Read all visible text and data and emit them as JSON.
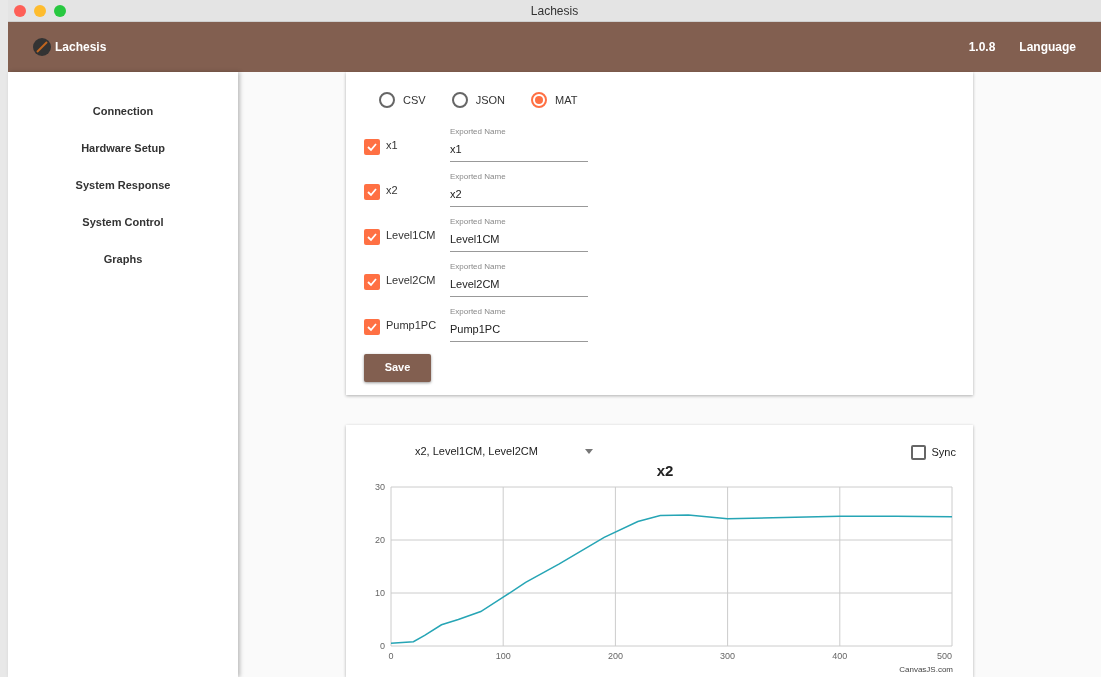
{
  "window": {
    "title": "Lachesis"
  },
  "header": {
    "app_name": "Lachesis",
    "version": "1.0.8",
    "language": "Language"
  },
  "sidebar": {
    "items": [
      {
        "label": "Connection"
      },
      {
        "label": "Hardware Setup"
      },
      {
        "label": "System Response"
      },
      {
        "label": "System Control"
      },
      {
        "label": "Graphs"
      }
    ]
  },
  "export": {
    "formats": [
      {
        "label": "CSV",
        "selected": false
      },
      {
        "label": "JSON",
        "selected": false
      },
      {
        "label": "MAT",
        "selected": true
      }
    ],
    "variables": [
      {
        "label": "x1",
        "checked": true,
        "field_label": "Exported Name",
        "value": "x1"
      },
      {
        "label": "x2",
        "checked": true,
        "field_label": "Exported Name",
        "value": "x2"
      },
      {
        "label": "Level1CM",
        "checked": true,
        "field_label": "Exported Name",
        "value": "Level1CM"
      },
      {
        "label": "Level2CM",
        "checked": true,
        "field_label": "Exported Name",
        "value": "Level2CM"
      },
      {
        "label": "Pump1PC",
        "checked": true,
        "field_label": "Exported Name",
        "value": "Pump1PC"
      }
    ],
    "save": "Save"
  },
  "graph": {
    "select_value": "x2, Level1CM, Level2CM",
    "sync": {
      "label": "Sync",
      "checked": false
    },
    "credit": "CanvasJS.com",
    "chart_data": {
      "type": "line",
      "title": "x2",
      "x": [
        0,
        20,
        30,
        45,
        60,
        80,
        100,
        120,
        150,
        190,
        220,
        240,
        265,
        300,
        340,
        400,
        450,
        500
      ],
      "series": [
        {
          "color": "#26a5b5",
          "values": [
            0.5,
            0.8,
            2,
            4,
            5,
            6.5,
            9.2,
            12,
            15.5,
            20.5,
            23.5,
            24.6,
            24.7,
            24,
            24.2,
            24.5,
            24.5,
            24.4
          ]
        }
      ],
      "xlim": [
        0,
        500
      ],
      "ylim": [
        0,
        30
      ],
      "xticks": [
        0,
        100,
        200,
        300,
        400,
        500
      ],
      "yticks": [
        0,
        10,
        20,
        30
      ],
      "grid": true
    }
  }
}
